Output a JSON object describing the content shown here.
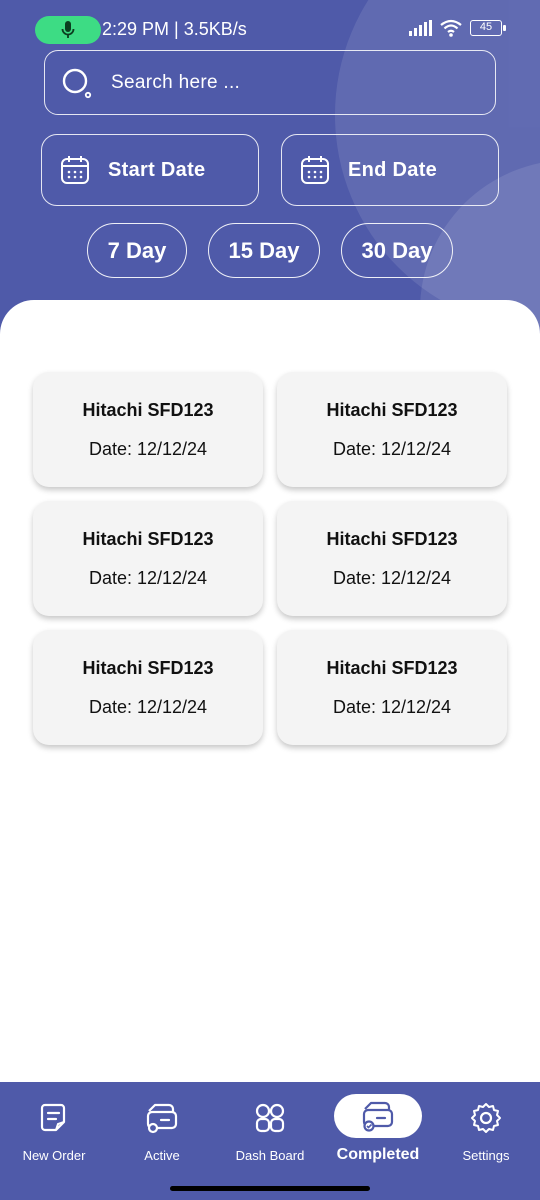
{
  "status_bar": {
    "time_speed": "2:29 PM | 3.5KB/s",
    "battery": "45"
  },
  "search": {
    "placeholder": "Search here ..."
  },
  "date_filters": {
    "start_label": "Start Date",
    "end_label": "End Date"
  },
  "quick_ranges": [
    "7 Day",
    "15 Day",
    "30 Day"
  ],
  "orders": [
    {
      "title": "Hitachi SFD123",
      "date": "Date: 12/12/24"
    },
    {
      "title": "Hitachi SFD123",
      "date": "Date: 12/12/24"
    },
    {
      "title": "Hitachi SFD123",
      "date": "Date: 12/12/24"
    },
    {
      "title": "Hitachi SFD123",
      "date": "Date: 12/12/24"
    },
    {
      "title": "Hitachi SFD123",
      "date": "Date: 12/12/24"
    },
    {
      "title": "Hitachi SFD123",
      "date": "Date: 12/12/24"
    }
  ],
  "nav": {
    "items": [
      {
        "label": "New Order",
        "icon": "new-order-icon"
      },
      {
        "label": "Active",
        "icon": "truck-icon"
      },
      {
        "label": "Dash Board",
        "icon": "dashboard-grid-icon"
      },
      {
        "label": "Completed",
        "icon": "completed-truck-icon"
      },
      {
        "label": "Settings",
        "icon": "gear-icon"
      }
    ],
    "active_index": 3
  },
  "colors": {
    "primary": "#4f5aa9",
    "card_bg": "#f4f4f4",
    "mic_green": "#3ddc84"
  }
}
